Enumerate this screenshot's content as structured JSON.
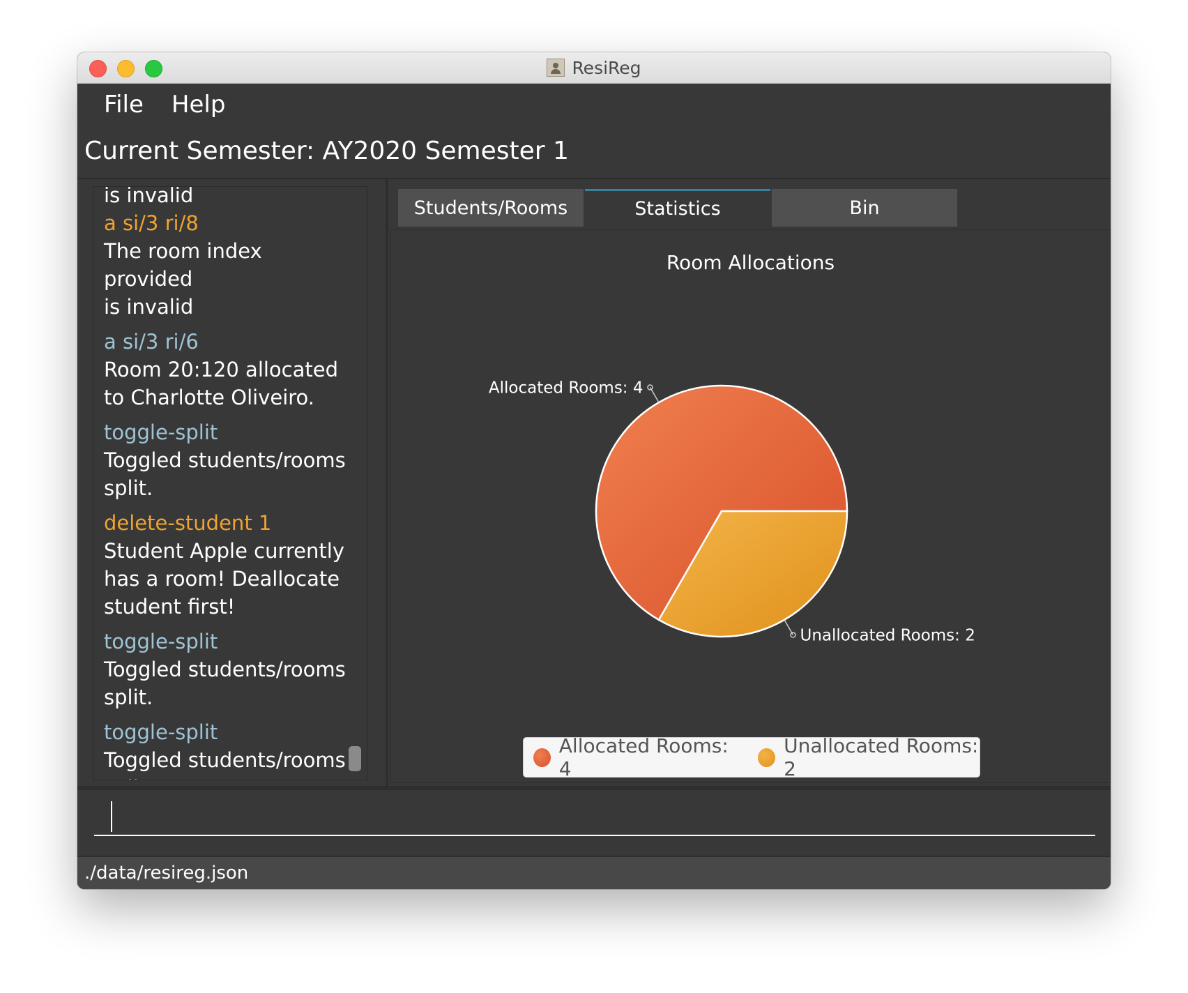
{
  "window": {
    "title": "ResiReg",
    "app_icon": "person-portrait-icon"
  },
  "menu": [
    {
      "label": "File"
    },
    {
      "label": "Help"
    }
  ],
  "semester_label": "Current Semester: AY2020 Semester 1",
  "history": {
    "partial_top": "is invalid",
    "entries": [
      {
        "command": "a si/3 ri/8",
        "command_color": "#f0a330",
        "result": [
          "The room index provided",
          "is invalid"
        ]
      },
      {
        "command": "a si/3 ri/6",
        "command_color": "#9ec3d4",
        "result": [
          "Room 20:120 allocated",
          "to Charlotte Oliveiro."
        ]
      },
      {
        "command": "toggle-split",
        "command_color": "#9ec3d4",
        "result": [
          "Toggled students/rooms",
          "split."
        ]
      },
      {
        "command": "delete-student 1",
        "command_color": "#f0a330",
        "result": [
          "Student Apple currently",
          "has a room! Deallocate",
          "student first!"
        ]
      },
      {
        "command": "toggle-split",
        "command_color": "#9ec3d4",
        "result": [
          "Toggled students/rooms",
          "split."
        ]
      },
      {
        "command": "toggle-split",
        "command_color": "#9ec3d4",
        "result": [
          "Toggled students/rooms",
          "split."
        ]
      }
    ]
  },
  "tabs": [
    {
      "label": "Students/Rooms",
      "active": false
    },
    {
      "label": "Statistics",
      "active": true
    },
    {
      "label": "Bin",
      "active": false
    }
  ],
  "chart_data": {
    "type": "pie",
    "title": "Room Allocations",
    "slices": [
      {
        "label": "Allocated Rooms: 4",
        "value": 4,
        "color": "#e0603a"
      },
      {
        "label": "Unallocated Rooms: 2",
        "value": 2,
        "color": "#eba12e"
      }
    ],
    "legend_position": "bottom"
  },
  "command_input": {
    "value": ""
  },
  "status_bar": {
    "path": "./data/resireg.json"
  }
}
